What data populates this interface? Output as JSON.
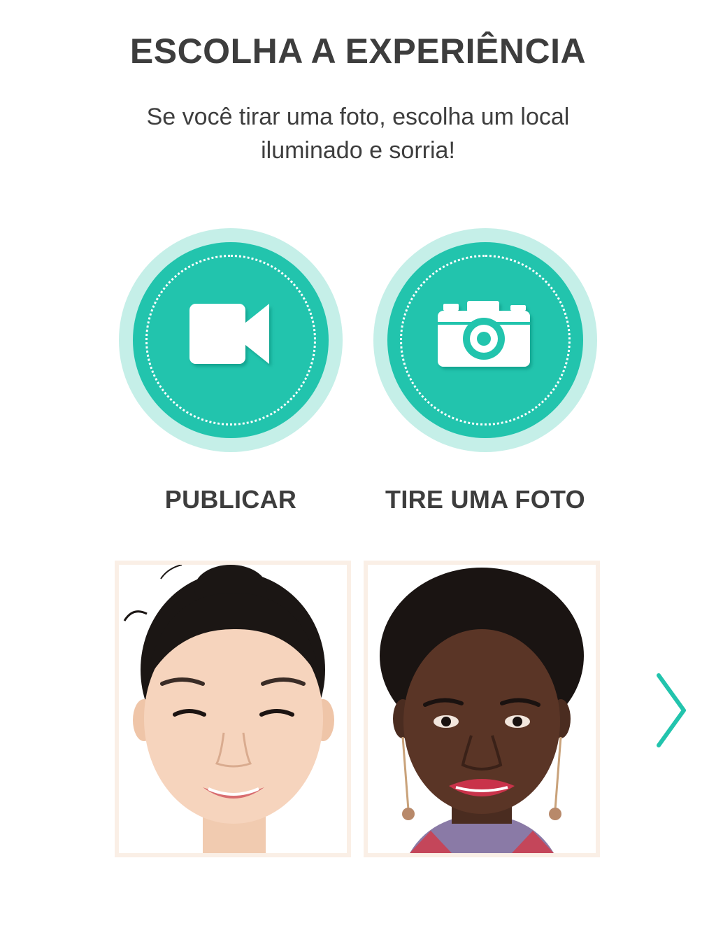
{
  "header": {
    "title": "ESCOLHA A EXPERIÊNCIA",
    "subtitle": "Se você tirar uma foto, escolha um local iluminado e sorria!"
  },
  "options": [
    {
      "label": "PUBLICAR",
      "icon": "video-camera-icon"
    },
    {
      "label": "TIRE UMA FOTO",
      "icon": "photo-camera-icon"
    }
  ],
  "models": [
    {
      "name": "model-1"
    },
    {
      "name": "model-2"
    }
  ],
  "navigation": {
    "icon": "chevron-right-icon"
  },
  "colors": {
    "accent": "#22c4ad",
    "accent_light": "#c5efe8",
    "text": "#3d3d3d",
    "card_border": "#faefe6"
  }
}
